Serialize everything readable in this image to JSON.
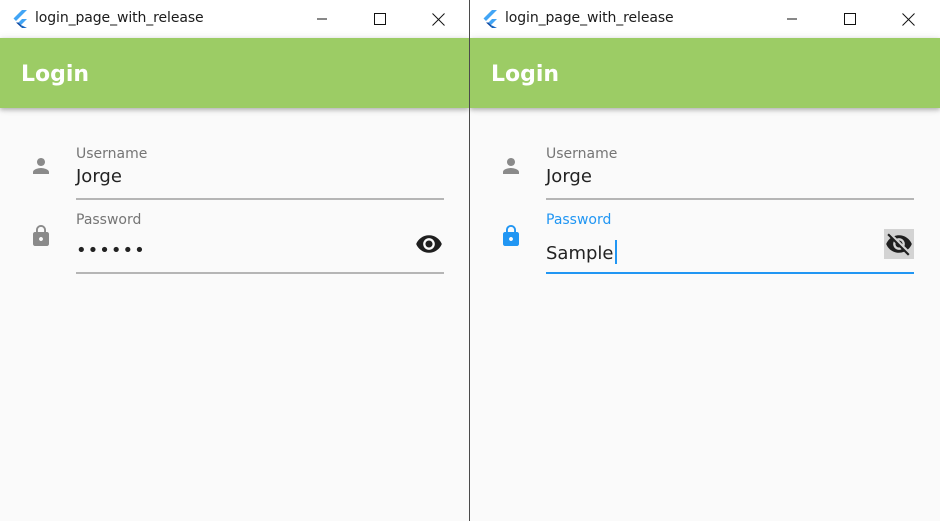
{
  "windows": [
    {
      "title": "login_page_with_release",
      "appbar_title": "Login",
      "username": {
        "label": "Username",
        "value": "Jorge",
        "icon": "person-icon"
      },
      "password": {
        "label": "Password",
        "value": "••••••",
        "icon": "lock-icon",
        "visibility_icon": "visibility-icon",
        "focused": false
      }
    },
    {
      "title": "login_page_with_release",
      "appbar_title": "Login",
      "username": {
        "label": "Username",
        "value": "Jorge",
        "icon": "person-icon"
      },
      "password": {
        "label": "Password",
        "value": "Sample",
        "icon": "lock-icon",
        "visibility_icon": "visibility-off-icon",
        "focused": true
      }
    }
  ],
  "colors": {
    "appbar": "#9ccc65",
    "accent": "#2196f3",
    "icon_inactive": "#8a8a8a"
  }
}
